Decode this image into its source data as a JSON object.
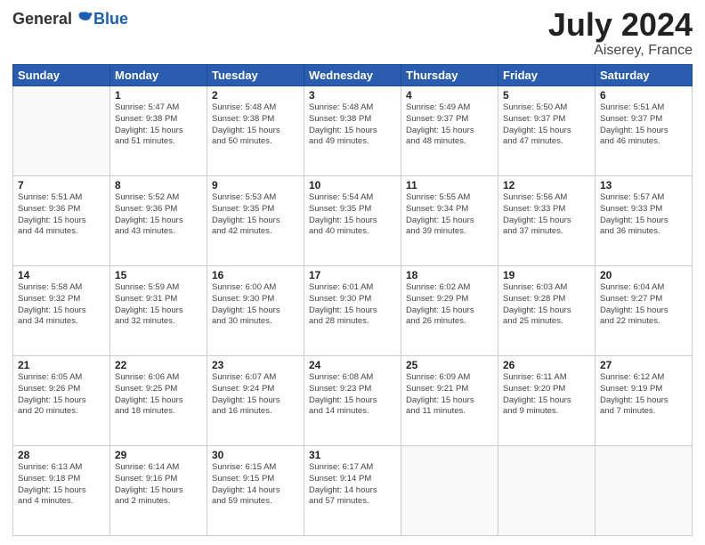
{
  "header": {
    "logo_general": "General",
    "logo_blue": "Blue",
    "month": "July 2024",
    "location": "Aiserey, France"
  },
  "weekdays": [
    "Sunday",
    "Monday",
    "Tuesday",
    "Wednesday",
    "Thursday",
    "Friday",
    "Saturday"
  ],
  "weeks": [
    [
      {
        "day": "",
        "info": ""
      },
      {
        "day": "1",
        "info": "Sunrise: 5:47 AM\nSunset: 9:38 PM\nDaylight: 15 hours\nand 51 minutes."
      },
      {
        "day": "2",
        "info": "Sunrise: 5:48 AM\nSunset: 9:38 PM\nDaylight: 15 hours\nand 50 minutes."
      },
      {
        "day": "3",
        "info": "Sunrise: 5:48 AM\nSunset: 9:38 PM\nDaylight: 15 hours\nand 49 minutes."
      },
      {
        "day": "4",
        "info": "Sunrise: 5:49 AM\nSunset: 9:37 PM\nDaylight: 15 hours\nand 48 minutes."
      },
      {
        "day": "5",
        "info": "Sunrise: 5:50 AM\nSunset: 9:37 PM\nDaylight: 15 hours\nand 47 minutes."
      },
      {
        "day": "6",
        "info": "Sunrise: 5:51 AM\nSunset: 9:37 PM\nDaylight: 15 hours\nand 46 minutes."
      }
    ],
    [
      {
        "day": "7",
        "info": "Sunrise: 5:51 AM\nSunset: 9:36 PM\nDaylight: 15 hours\nand 44 minutes."
      },
      {
        "day": "8",
        "info": "Sunrise: 5:52 AM\nSunset: 9:36 PM\nDaylight: 15 hours\nand 43 minutes."
      },
      {
        "day": "9",
        "info": "Sunrise: 5:53 AM\nSunset: 9:35 PM\nDaylight: 15 hours\nand 42 minutes."
      },
      {
        "day": "10",
        "info": "Sunrise: 5:54 AM\nSunset: 9:35 PM\nDaylight: 15 hours\nand 40 minutes."
      },
      {
        "day": "11",
        "info": "Sunrise: 5:55 AM\nSunset: 9:34 PM\nDaylight: 15 hours\nand 39 minutes."
      },
      {
        "day": "12",
        "info": "Sunrise: 5:56 AM\nSunset: 9:33 PM\nDaylight: 15 hours\nand 37 minutes."
      },
      {
        "day": "13",
        "info": "Sunrise: 5:57 AM\nSunset: 9:33 PM\nDaylight: 15 hours\nand 36 minutes."
      }
    ],
    [
      {
        "day": "14",
        "info": "Sunrise: 5:58 AM\nSunset: 9:32 PM\nDaylight: 15 hours\nand 34 minutes."
      },
      {
        "day": "15",
        "info": "Sunrise: 5:59 AM\nSunset: 9:31 PM\nDaylight: 15 hours\nand 32 minutes."
      },
      {
        "day": "16",
        "info": "Sunrise: 6:00 AM\nSunset: 9:30 PM\nDaylight: 15 hours\nand 30 minutes."
      },
      {
        "day": "17",
        "info": "Sunrise: 6:01 AM\nSunset: 9:30 PM\nDaylight: 15 hours\nand 28 minutes."
      },
      {
        "day": "18",
        "info": "Sunrise: 6:02 AM\nSunset: 9:29 PM\nDaylight: 15 hours\nand 26 minutes."
      },
      {
        "day": "19",
        "info": "Sunrise: 6:03 AM\nSunset: 9:28 PM\nDaylight: 15 hours\nand 25 minutes."
      },
      {
        "day": "20",
        "info": "Sunrise: 6:04 AM\nSunset: 9:27 PM\nDaylight: 15 hours\nand 22 minutes."
      }
    ],
    [
      {
        "day": "21",
        "info": "Sunrise: 6:05 AM\nSunset: 9:26 PM\nDaylight: 15 hours\nand 20 minutes."
      },
      {
        "day": "22",
        "info": "Sunrise: 6:06 AM\nSunset: 9:25 PM\nDaylight: 15 hours\nand 18 minutes."
      },
      {
        "day": "23",
        "info": "Sunrise: 6:07 AM\nSunset: 9:24 PM\nDaylight: 15 hours\nand 16 minutes."
      },
      {
        "day": "24",
        "info": "Sunrise: 6:08 AM\nSunset: 9:23 PM\nDaylight: 15 hours\nand 14 minutes."
      },
      {
        "day": "25",
        "info": "Sunrise: 6:09 AM\nSunset: 9:21 PM\nDaylight: 15 hours\nand 11 minutes."
      },
      {
        "day": "26",
        "info": "Sunrise: 6:11 AM\nSunset: 9:20 PM\nDaylight: 15 hours\nand 9 minutes."
      },
      {
        "day": "27",
        "info": "Sunrise: 6:12 AM\nSunset: 9:19 PM\nDaylight: 15 hours\nand 7 minutes."
      }
    ],
    [
      {
        "day": "28",
        "info": "Sunrise: 6:13 AM\nSunset: 9:18 PM\nDaylight: 15 hours\nand 4 minutes."
      },
      {
        "day": "29",
        "info": "Sunrise: 6:14 AM\nSunset: 9:16 PM\nDaylight: 15 hours\nand 2 minutes."
      },
      {
        "day": "30",
        "info": "Sunrise: 6:15 AM\nSunset: 9:15 PM\nDaylight: 14 hours\nand 59 minutes."
      },
      {
        "day": "31",
        "info": "Sunrise: 6:17 AM\nSunset: 9:14 PM\nDaylight: 14 hours\nand 57 minutes."
      },
      {
        "day": "",
        "info": ""
      },
      {
        "day": "",
        "info": ""
      },
      {
        "day": "",
        "info": ""
      }
    ]
  ]
}
